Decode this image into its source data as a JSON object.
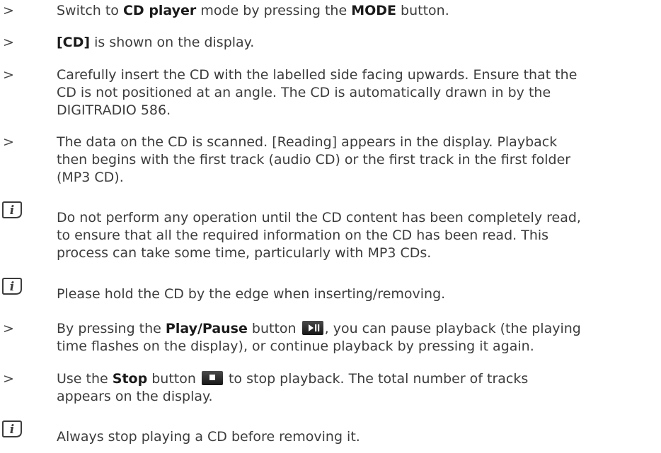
{
  "steps": {
    "s1": {
      "marker": ">",
      "t1": "Switch to ",
      "b1": "CD player",
      "t2": " mode by pressing the ",
      "b2": "MODE",
      "t3": " button."
    },
    "s2": {
      "marker": ">",
      "b1": "[CD]",
      "t1": " is shown on the display."
    },
    "s3": {
      "marker": ">",
      "l1": "Carefully insert the CD with the labelled side facing upwards. Ensure that the",
      "l2": "CD is not positioned at an angle. The CD is automatically drawn in by the",
      "l3": "DIGITRADIO 586."
    },
    "s4": {
      "marker": ">",
      "l1": "The data on the CD is scanned. [Reading] appears in the display. Playback",
      "l2": "then begins with the first track (audio CD) or the first track in the first folder",
      "l3": "(MP3 CD)."
    },
    "n1": {
      "l1": "Do not perform any operation until the CD content has been completely read,",
      "l2": "to ensure that all the required information on the CD has been read. This",
      "l3": "process can take some time, particularly with MP3 CDs."
    },
    "n2": {
      "l1": "Please hold the CD by the edge when inserting/removing."
    },
    "s5": {
      "marker": ">",
      "t1": "By pressing the ",
      "b1": "Play/Pause",
      "t2": " button ",
      "t3": ", you can pause playback (the playing",
      "l2": "time flashes on the display), or continue playback by pressing it again."
    },
    "s6": {
      "marker": ">",
      "t1": "Use the ",
      "b1": "Stop",
      "t2": " button ",
      "t3": " to stop playback. The total number of tracks",
      "l2": "appears on the display."
    },
    "n3": {
      "l1": "Always stop playing a CD before removing it."
    }
  },
  "icons": {
    "info": "info-icon",
    "play_pause": "play-pause-button-icon",
    "stop": "stop-button-icon"
  }
}
